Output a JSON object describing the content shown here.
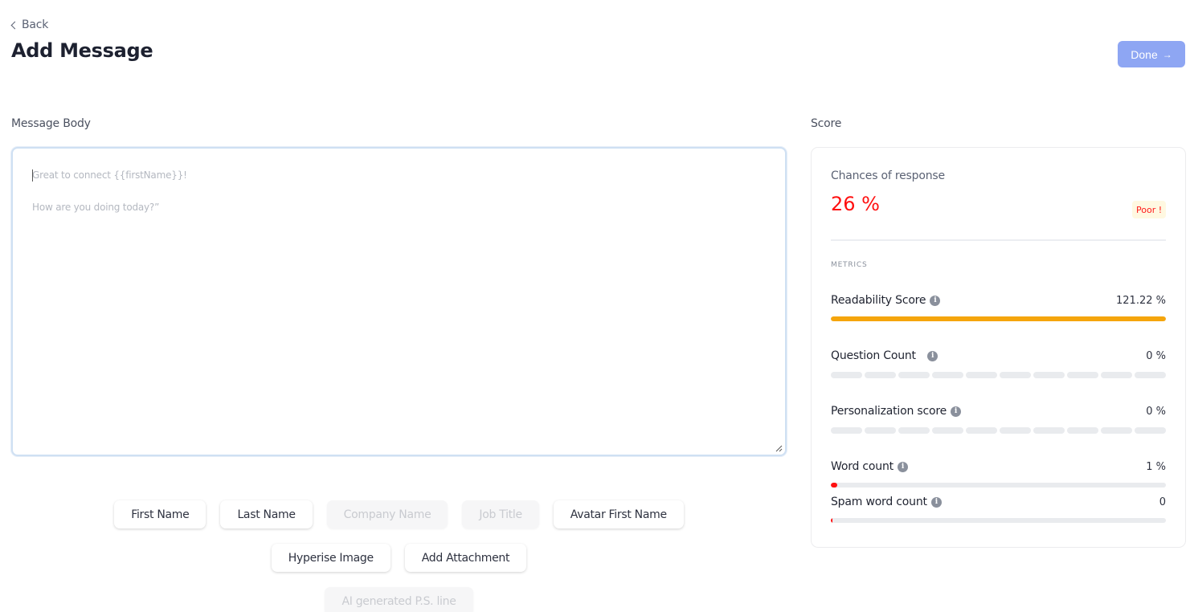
{
  "header": {
    "back_label": "Back",
    "title": "Add Message",
    "done_label": "Done",
    "done_icon": "arrow-right-icon",
    "done_color": "#8ea6f3"
  },
  "message_body": {
    "label": "Message Body",
    "lines": [
      "Great to connect {{firstName}}!",
      "How are you doing today?”"
    ]
  },
  "variables": {
    "row1": [
      {
        "label": "First Name",
        "disabled": false
      },
      {
        "label": "Last Name",
        "disabled": false
      },
      {
        "label": "Company Name",
        "disabled": true
      },
      {
        "label": "Job Title",
        "disabled": true
      },
      {
        "label": "Avatar First Name",
        "disabled": false
      }
    ],
    "row2": [
      {
        "label": "Hyperise Image",
        "disabled": false
      },
      {
        "label": "Add Attachment",
        "disabled": false
      }
    ],
    "row3": [
      {
        "label": "AI generated P.S. line",
        "disabled": true
      }
    ]
  },
  "score": {
    "label": "Score",
    "chances_label": "Chances of response",
    "chances_value": "26 %",
    "rating": "Poor !",
    "metrics_label": "METRICS",
    "metrics": [
      {
        "name": "Readability Score",
        "value": "121.22 %",
        "fill_fraction": 1.0,
        "color": "#f5a50c",
        "style": "full"
      },
      {
        "name": "Question Count",
        "value": "0 %",
        "fill_fraction": 0,
        "segments": 10,
        "style": "segmented"
      },
      {
        "name": "Personalization score",
        "value": "0 %",
        "fill_fraction": 0,
        "segments": 10,
        "style": "segmented"
      },
      {
        "name": "Word count",
        "value": "1 %",
        "fill_fraction": 0.01,
        "color": "#ff1010",
        "style": "full"
      },
      {
        "name": "Spam word count",
        "value": "0",
        "fill_fraction": 0.003,
        "color": "#ff1010",
        "style": "full"
      }
    ]
  }
}
